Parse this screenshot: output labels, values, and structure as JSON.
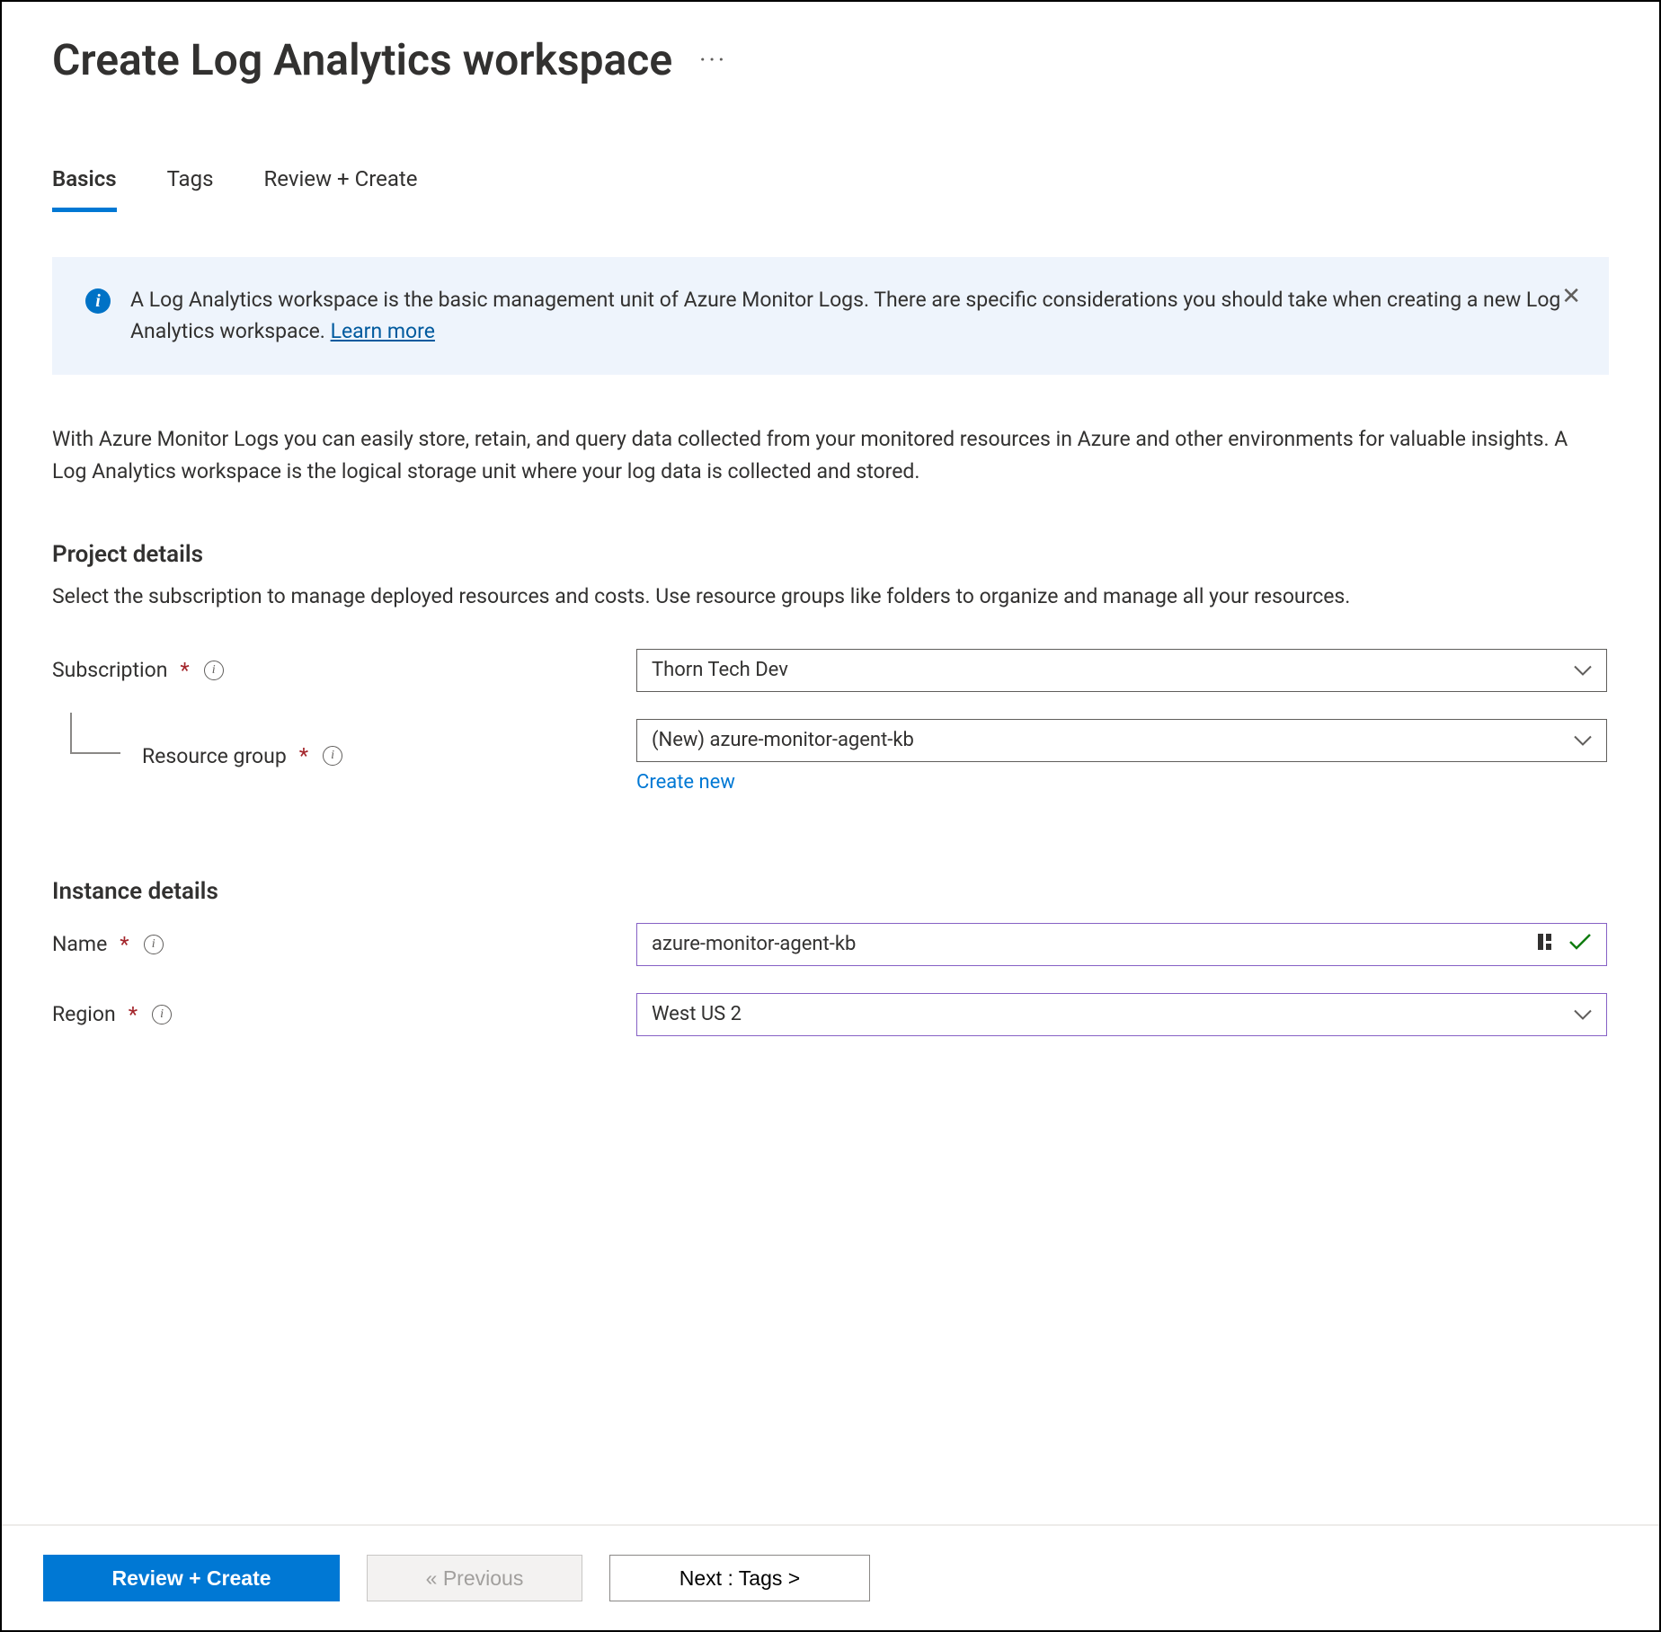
{
  "title": "Create Log Analytics workspace",
  "tabs": [
    "Basics",
    "Tags",
    "Review + Create"
  ],
  "info_box": {
    "text_a": "A Log Analytics workspace is the basic management unit of Azure Monitor Logs. There are specific considerations you should take when creating a new Log Analytics workspace. ",
    "learn_more": "Learn more"
  },
  "intro_text": "With Azure Monitor Logs you can easily store, retain, and query data collected from your monitored resources in Azure and other environments for valuable insights. A Log Analytics workspace is the logical storage unit where your log data is collected and stored.",
  "project_details": {
    "heading": "Project details",
    "sub": "Select the subscription to manage deployed resources and costs. Use resource groups like folders to organize and manage all your resources.",
    "subscription_label": "Subscription",
    "subscription_value": "Thorn Tech Dev",
    "resource_group_label": "Resource group",
    "resource_group_value": "(New) azure-monitor-agent-kb",
    "create_new": "Create new"
  },
  "instance_details": {
    "heading": "Instance details",
    "name_label": "Name",
    "name_value": "azure-monitor-agent-kb",
    "region_label": "Region",
    "region_value": "West US 2"
  },
  "footer": {
    "review": "Review + Create",
    "previous": "« Previous",
    "next": "Next : Tags >"
  }
}
